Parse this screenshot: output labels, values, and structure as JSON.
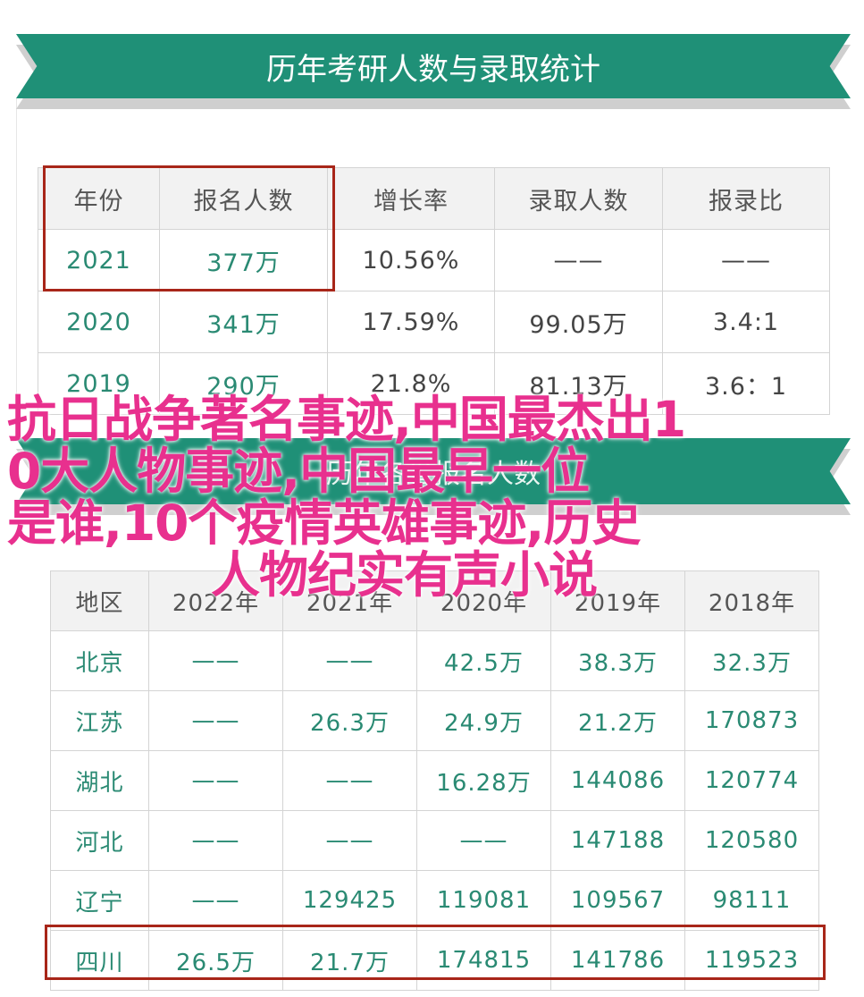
{
  "banner1": {
    "title": "历年考研人数与录取统计"
  },
  "table1": {
    "headers": [
      "年份",
      "报名人数",
      "增长率",
      "录取人数",
      "报录比"
    ],
    "rows": [
      [
        "2021",
        "377万",
        "10.56%",
        "——",
        "——"
      ],
      [
        "2020",
        "341万",
        "17.59%",
        "99.05万",
        "3.4:1"
      ],
      [
        "2019",
        "290万",
        "21.8%",
        "81.13万",
        "3.6：1"
      ]
    ]
  },
  "banner2": {
    "title": "历年各省报名人数"
  },
  "table2": {
    "headers": [
      "地区",
      "2022年",
      "2021年",
      "2020年",
      "2019年",
      "2018年"
    ],
    "rows": [
      [
        "北京",
        "——",
        "——",
        "42.5万",
        "38.3万",
        "32.3万"
      ],
      [
        "江苏",
        "——",
        "26.3万",
        "24.9万",
        "21.2万",
        "170873"
      ],
      [
        "湖北",
        "——",
        "——",
        "16.28万",
        "144086",
        "120774"
      ],
      [
        "河北",
        "——",
        "——",
        "——",
        "147188",
        "120580"
      ],
      [
        "辽宁",
        "——",
        "129425",
        "119081",
        "109567",
        "98111"
      ],
      [
        "四川",
        "26.5万",
        "21.7万",
        "174815",
        "141786",
        "119523"
      ]
    ]
  },
  "overlay": {
    "lines": [
      "抗日战争著名事迹,中国最杰出1",
      "0大人物事迹,中国最早一位",
      "是谁,10个疫情英雄事迹,历史",
      "人物纪实有声小说"
    ]
  },
  "colors": {
    "banner": "#1f9077",
    "highlight": "#a82619",
    "overlay_text": "#e8308e",
    "cell_text": "#2a8a73"
  }
}
